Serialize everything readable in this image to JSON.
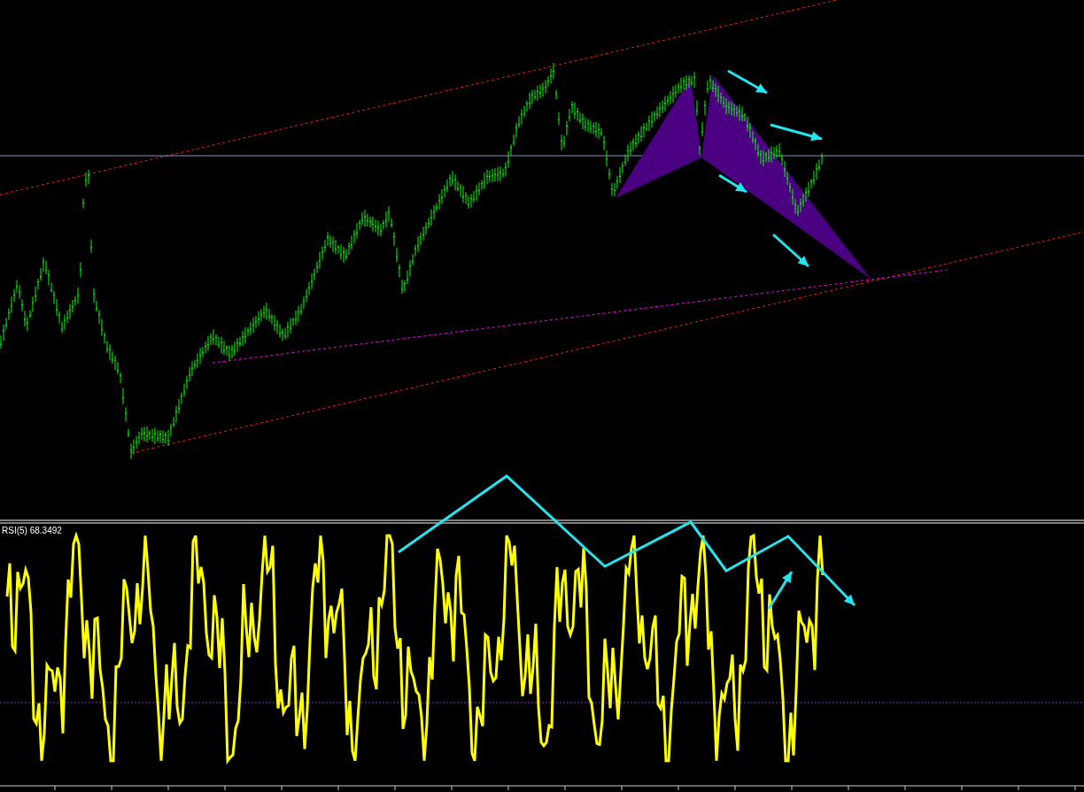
{
  "indicator": {
    "label": "RSI(5) 68.3492"
  }
}
